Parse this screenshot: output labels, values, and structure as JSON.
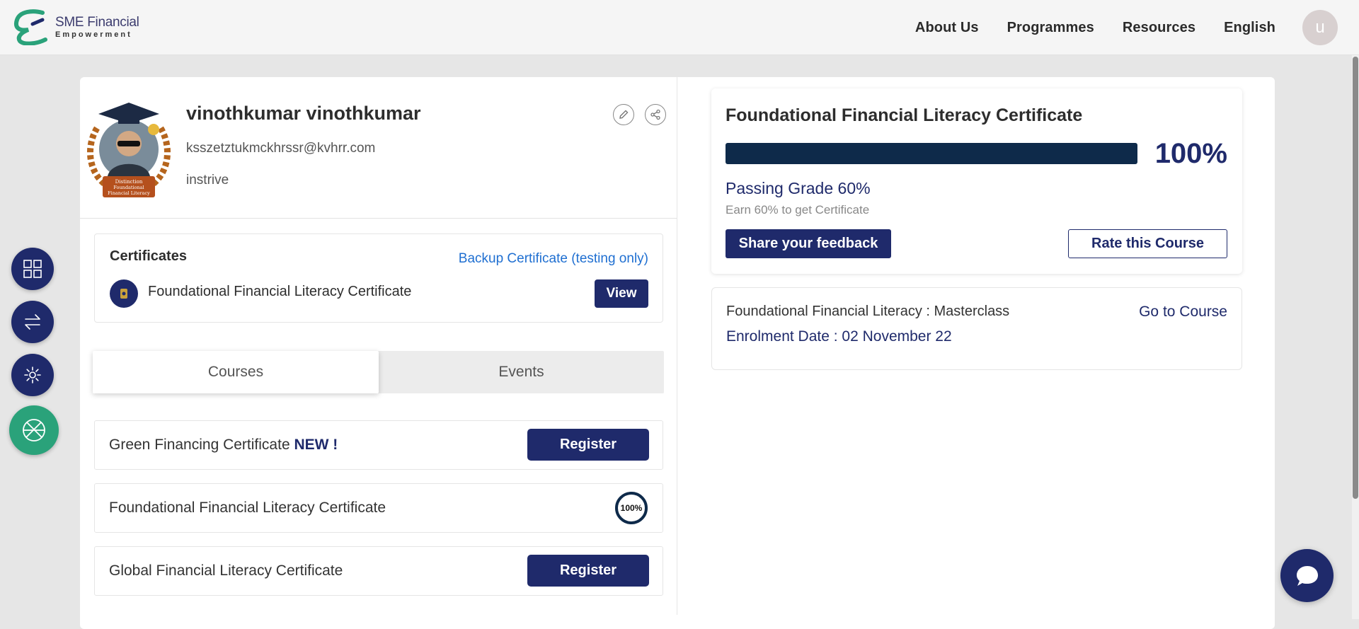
{
  "brand": {
    "name": "SME Financial",
    "tagline": "Empowerment",
    "accent": "#1f2a6b",
    "green": "#2aa27a"
  },
  "nav": {
    "items": [
      "About Us",
      "Programmes",
      "Resources",
      "English"
    ],
    "avatar_letter": "u"
  },
  "profile": {
    "name": "vinothkumar vinothkumar",
    "email": "ksszetztukmckhrssr@kvhrr.com",
    "org": "instrive",
    "badge_text": [
      "Distinction",
      "Foundational",
      "Financial Literacy"
    ]
  },
  "certificates": {
    "title": "Certificates",
    "backup_link": "Backup Certificate (testing only)",
    "items": [
      {
        "name": "Foundational Financial Literacy Certificate",
        "action": "View"
      }
    ]
  },
  "tabs": {
    "courses": "Courses",
    "events": "Events",
    "active": "courses"
  },
  "courses": [
    {
      "title": "Green Financing Certificate",
      "badge": "NEW !",
      "action": "Register"
    },
    {
      "title": "Foundational Financial Literacy Certificate",
      "progress_label": "100%",
      "progress": 1.0
    },
    {
      "title": "Global Financial Literacy Certificate",
      "action": "Register"
    }
  ],
  "progress_card": {
    "title": "Foundational Financial Literacy Certificate",
    "progress": 1.0,
    "percent_label": "100%",
    "passing_grade": "Passing Grade 60%",
    "earn_text": "Earn 60% to get Certificate",
    "feedback_button": "Share your feedback",
    "rate_button": "Rate this Course"
  },
  "masterclass": {
    "title": "Foundational Financial Literacy : Masterclass",
    "go_to": "Go to Course",
    "enrolment": "Enrolment Date : 02 November 22"
  },
  "side_buttons": [
    "dashboard-icon",
    "switch-icon",
    "settings-icon",
    "globe-icon"
  ],
  "chat": {
    "icon": "chat-bubble-icon"
  }
}
